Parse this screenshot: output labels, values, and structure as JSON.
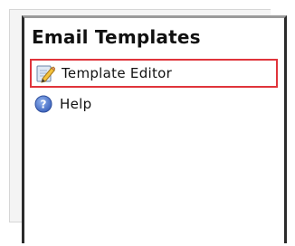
{
  "panel": {
    "title": "Email Templates"
  },
  "menu": {
    "items": [
      {
        "label": "Template Editor",
        "icon": "pencil-edit-icon",
        "selected": true
      },
      {
        "label": "Help",
        "icon": "help-icon",
        "selected": false
      }
    ]
  },
  "colors": {
    "selection_border": "#e0343b",
    "panel_border": "#2b2b2b",
    "help_icon": "#4a74c9"
  }
}
